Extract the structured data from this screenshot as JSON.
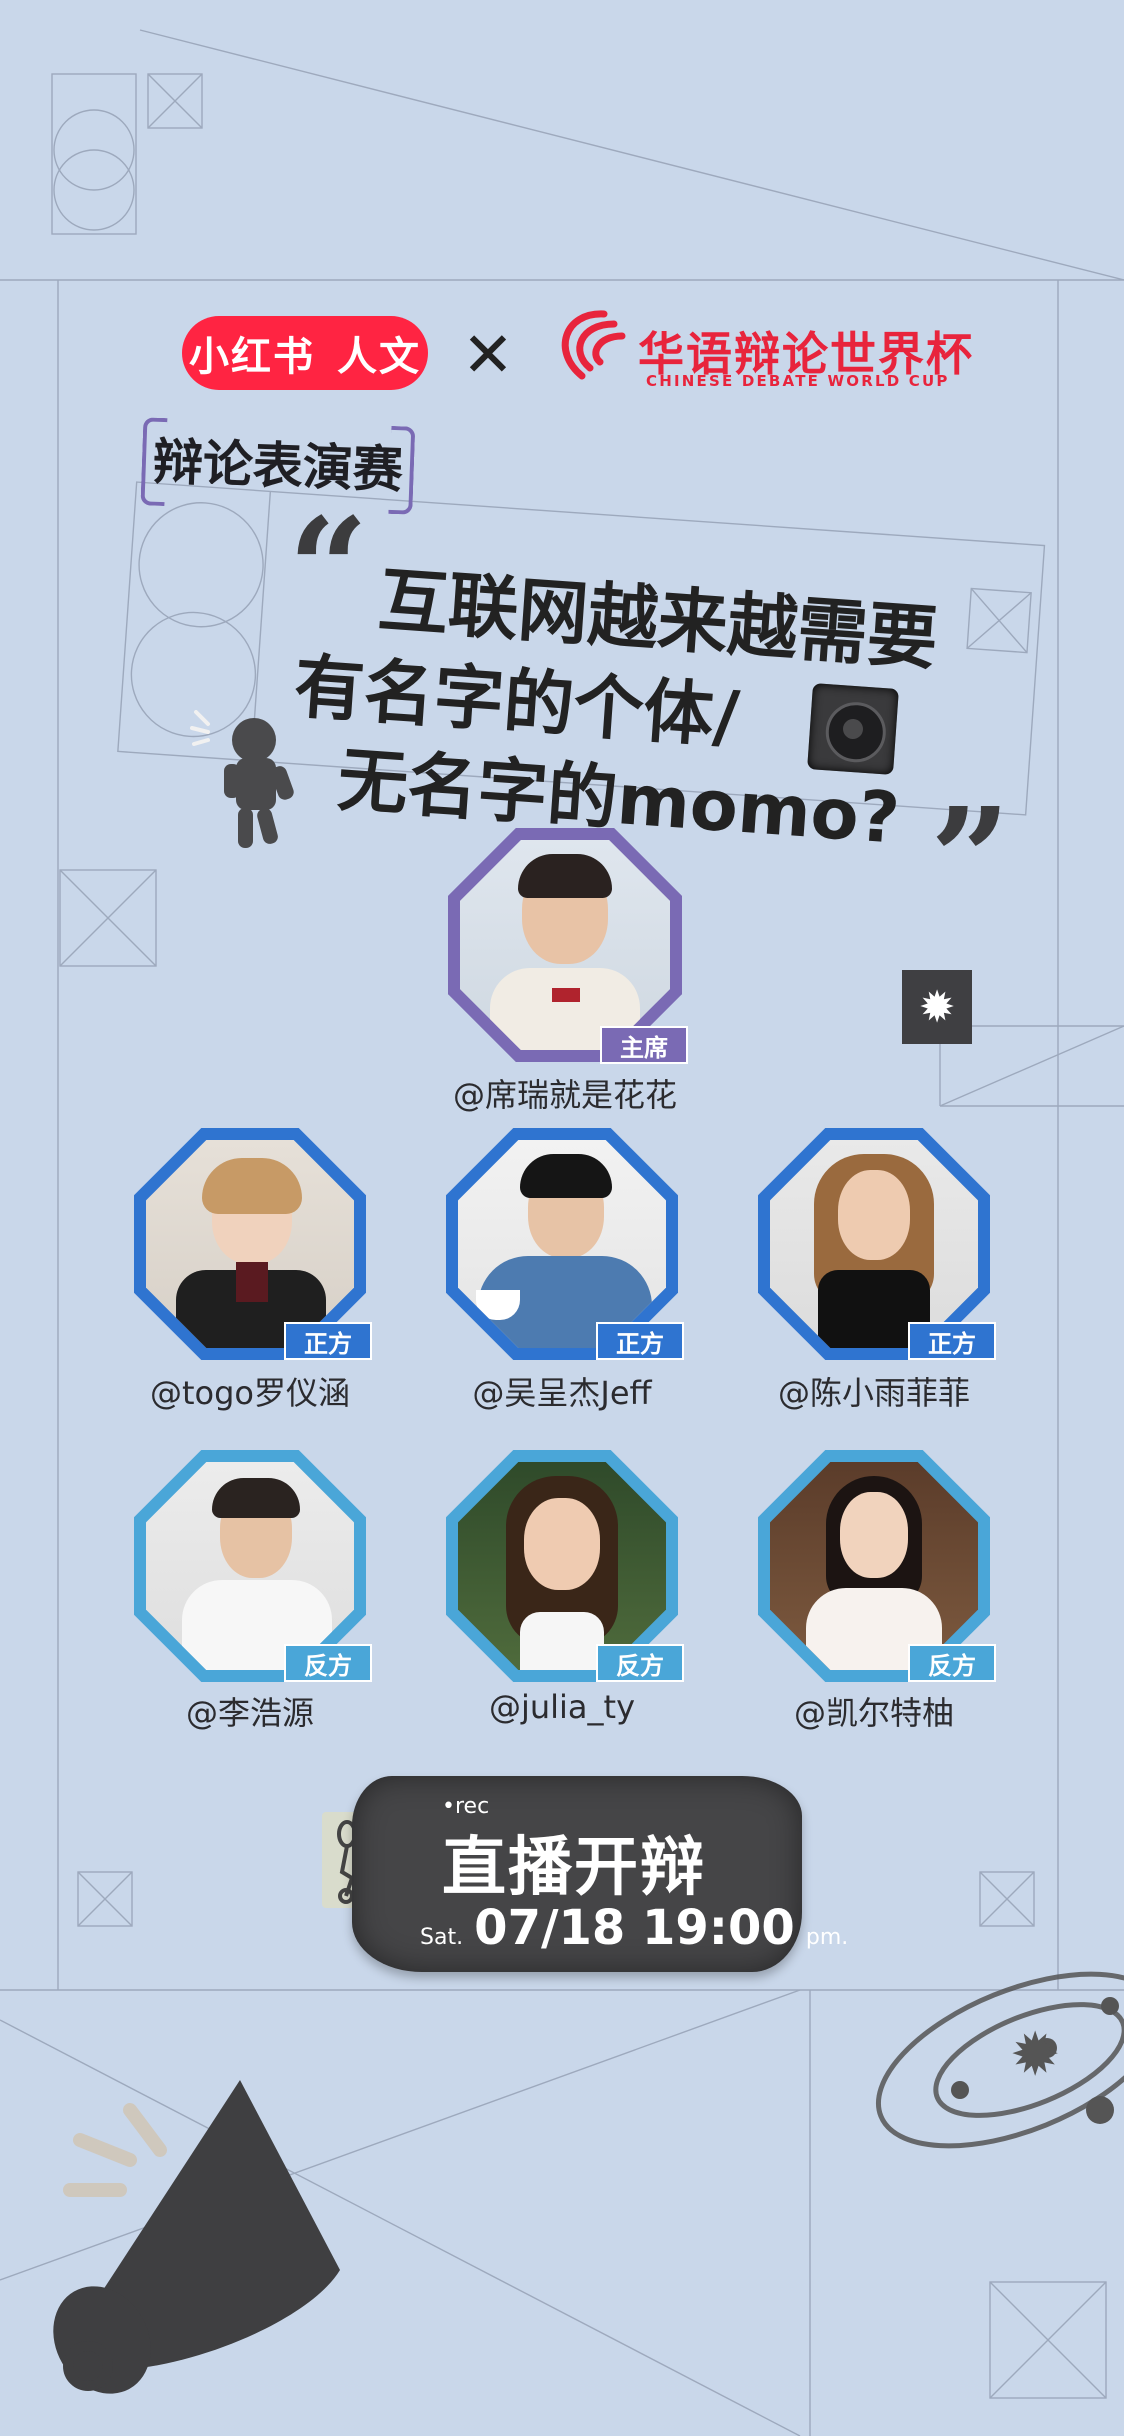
{
  "brand": {
    "xhs_logo_1": "小红书",
    "xhs_logo_2": "人文",
    "times": "✕",
    "cdwc_name": "华语辩论世界杯",
    "cdwc_sub": "CHINESE DEBATE WORLD CUP"
  },
  "tag": "辩论表演赛",
  "title": {
    "line1": "互联网越来越需要",
    "line2": "有名字的个体/",
    "line3": "无名字的momo?"
  },
  "host": {
    "handle": "@席瑞就是花花",
    "role": "主席"
  },
  "pro_team": [
    {
      "handle": "@togo罗仪涵",
      "role": "正方"
    },
    {
      "handle": "@吴呈杰Jeff",
      "role": "正方"
    },
    {
      "handle": "@陈小雨菲菲",
      "role": "正方"
    }
  ],
  "con_team": [
    {
      "handle": "@李浩源",
      "role": "反方"
    },
    {
      "handle": "@julia_ty",
      "role": "反方"
    },
    {
      "handle": "@凯尔特柚",
      "role": "反方"
    }
  ],
  "live": {
    "rec": "•rec",
    "title": "直播开辩",
    "day": "Sat.",
    "time": "07/18 19:00",
    "ampm": "pm."
  },
  "colors": {
    "background": "#c9d7ea",
    "host_frame": "#7a6ab4",
    "pro_frame": "#2f74d0",
    "con_frame": "#4aa6d8",
    "xhs_red": "#ff2442",
    "cdwc_red": "#e8243c"
  }
}
